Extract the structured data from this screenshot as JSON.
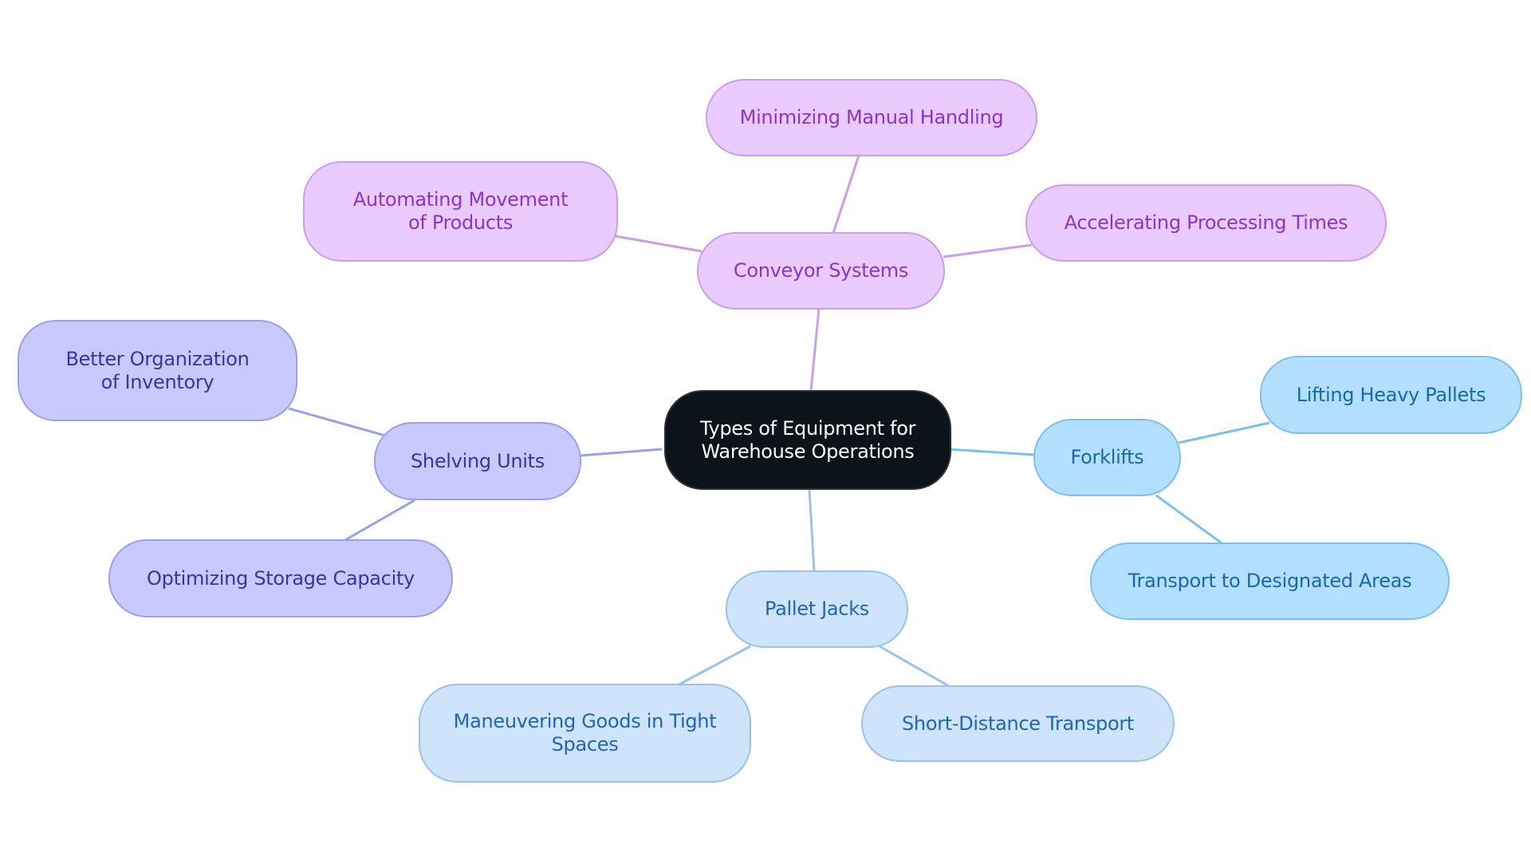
{
  "diagram": {
    "type": "mind-map",
    "root": {
      "label": "Types of Equipment for Warehouse Operations"
    },
    "branches": [
      {
        "label": "Conveyor Systems",
        "color": "#c99fe9",
        "children": [
          {
            "label": "Minimizing Manual Handling"
          },
          {
            "label": "Automating Movement of Products"
          },
          {
            "label": "Accelerating Processing Times"
          }
        ]
      },
      {
        "label": "Shelving Units",
        "color": "#9da0e6",
        "children": [
          {
            "label": "Better Organization of Inventory"
          },
          {
            "label": "Optimizing Storage Capacity"
          }
        ]
      },
      {
        "label": "Forklifts",
        "color": "#7ec0ea",
        "children": [
          {
            "label": "Lifting Heavy Pallets"
          },
          {
            "label": "Transport to Designated Areas"
          }
        ]
      },
      {
        "label": "Pallet Jacks",
        "color": "#9bc3e9",
        "children": [
          {
            "label": "Maneuvering Goods in Tight Spaces"
          },
          {
            "label": "Short-Distance Transport"
          }
        ]
      }
    ]
  },
  "colors": {
    "root_fill": "#0c131a",
    "conveyor_fill": "#eacbff",
    "shelving_fill": "#c8caff",
    "forklifts_fill": "#b3dfff",
    "pallet_jacks_fill": "#cde4fb"
  }
}
